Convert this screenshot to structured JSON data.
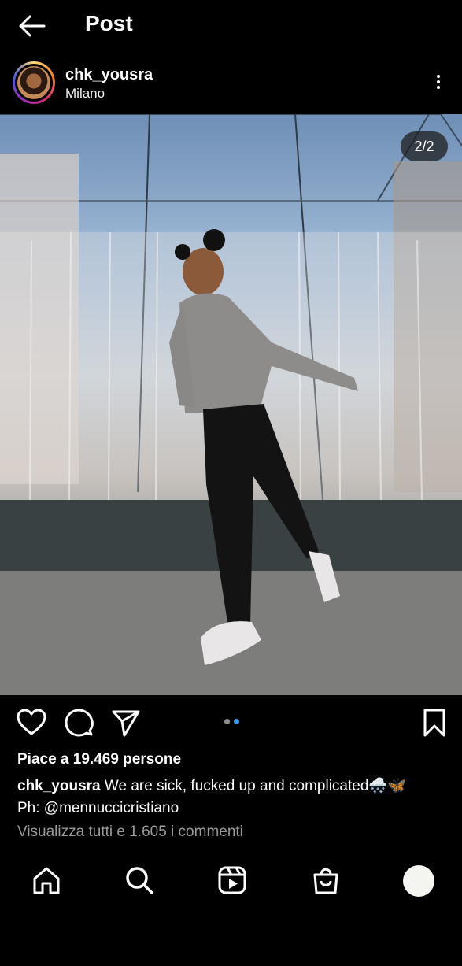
{
  "header": {
    "title": "Post"
  },
  "post": {
    "username": "chk_yousra",
    "location": "Milano",
    "photo_counter": "2/2",
    "likes_text": "Piace a 19.469 persone",
    "caption_user": "chk_yousra",
    "caption_text": "We are sick, fucked up and complicated🌨️🦋",
    "caption_line2": "Ph: @mennuccicristiano",
    "comments_link": "Visualizza tutti e 1.605 i commenti",
    "carousel": {
      "total": 2,
      "active": 2
    }
  },
  "icons": {
    "back": "arrow-left-icon",
    "more": "more-vertical-icon",
    "like": "heart-icon",
    "comment": "comment-icon",
    "share": "send-icon",
    "save": "bookmark-icon",
    "home": "home-icon",
    "search": "search-icon",
    "reels": "reels-icon",
    "shop": "shop-icon",
    "profile": "profile-avatar"
  },
  "colors": {
    "background": "#000000",
    "text": "#ffffff",
    "muted": "#9a9a9a",
    "carousel_active": "#3897f0",
    "carousel_inactive": "#8e8e8e"
  }
}
